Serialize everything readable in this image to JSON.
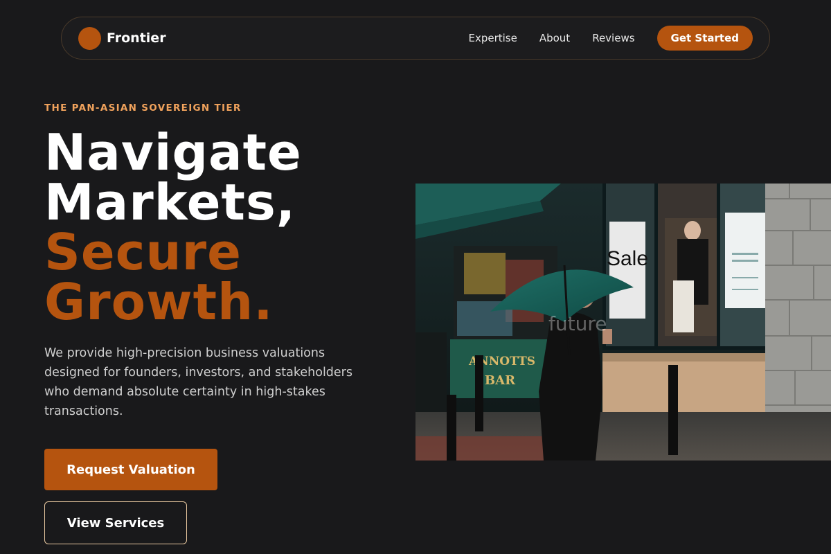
{
  "brand": {
    "name": "Frontier"
  },
  "nav": {
    "links": [
      "Expertise",
      "About",
      "Reviews"
    ],
    "cta": "Get Started"
  },
  "hero": {
    "eyebrow": "THE PAN-ASIAN SOVEREIGN TIER",
    "headline_white": [
      "Navigate",
      "Markets,"
    ],
    "headline_accent": [
      "Secure",
      "Growth."
    ],
    "description": "We provide high-precision business valuations designed for founders, investors, and stakeholders who demand absolute certainty in high-stakes transactions.",
    "primary_button": "Request Valuation",
    "secondary_button": "View Services"
  },
  "photo": {
    "sign_sale": "Sale",
    "sign_bar": "BAR",
    "sign_bar_top": "ANNOTTS",
    "watermark": "future"
  },
  "colors": {
    "background": "#19191b",
    "accent": "#b5540f",
    "eyebrow": "#f0a25c",
    "outline_border": "#e8c8a0"
  }
}
